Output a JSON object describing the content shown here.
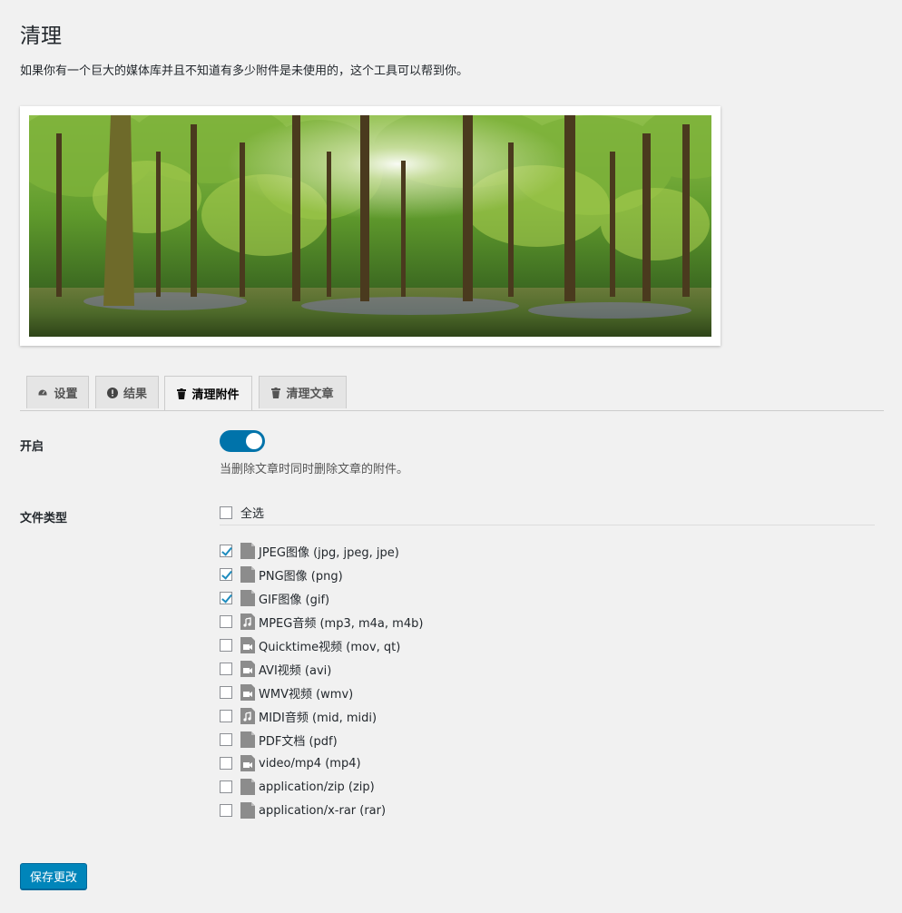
{
  "page": {
    "title": "清理",
    "description": "如果你有一个巨大的媒体库并且不知道有多少附件是未使用的，这个工具可以帮到你。"
  },
  "tabs": [
    {
      "label": "设置",
      "icon": "dashboard-icon",
      "active": false
    },
    {
      "label": "结果",
      "icon": "warning-icon",
      "active": false
    },
    {
      "label": "清理附件",
      "icon": "trash-icon",
      "active": true
    },
    {
      "label": "清理文章",
      "icon": "trash-icon",
      "active": false
    }
  ],
  "settings": {
    "enable_label": "开启",
    "enable_on": true,
    "enable_description": "当删除文章时同时删除文章的附件。",
    "file_types_label": "文件类型",
    "select_all_label": "全选",
    "select_all_checked": false
  },
  "file_types": [
    {
      "label": "JPEG图像 (jpg, jpeg, jpe)",
      "checked": true,
      "icon": "image-file-icon"
    },
    {
      "label": "PNG图像 (png)",
      "checked": true,
      "icon": "image-file-icon"
    },
    {
      "label": "GIF图像 (gif)",
      "checked": true,
      "icon": "image-file-icon"
    },
    {
      "label": "MPEG音频 (mp3, m4a, m4b)",
      "checked": false,
      "icon": "audio-file-icon"
    },
    {
      "label": "Quicktime视频 (mov, qt)",
      "checked": false,
      "icon": "video-file-icon"
    },
    {
      "label": "AVI视频 (avi)",
      "checked": false,
      "icon": "video-file-icon"
    },
    {
      "label": "WMV视频 (wmv)",
      "checked": false,
      "icon": "video-file-icon"
    },
    {
      "label": "MIDI音频 (mid, midi)",
      "checked": false,
      "icon": "audio-file-icon"
    },
    {
      "label": "PDF文档 (pdf)",
      "checked": false,
      "icon": "document-file-icon"
    },
    {
      "label": "video/mp4 (mp4)",
      "checked": false,
      "icon": "video-file-icon"
    },
    {
      "label": "application/zip (zip)",
      "checked": false,
      "icon": "document-file-icon"
    },
    {
      "label": "application/x-rar (rar)",
      "checked": false,
      "icon": "document-file-icon"
    }
  ],
  "actions": {
    "save_label": "保存更改"
  },
  "colors": {
    "primary": "#0085ba",
    "toggle_on": "#0073aa",
    "background": "#f1f1f1",
    "icon_gray": "#8c8c8c"
  }
}
